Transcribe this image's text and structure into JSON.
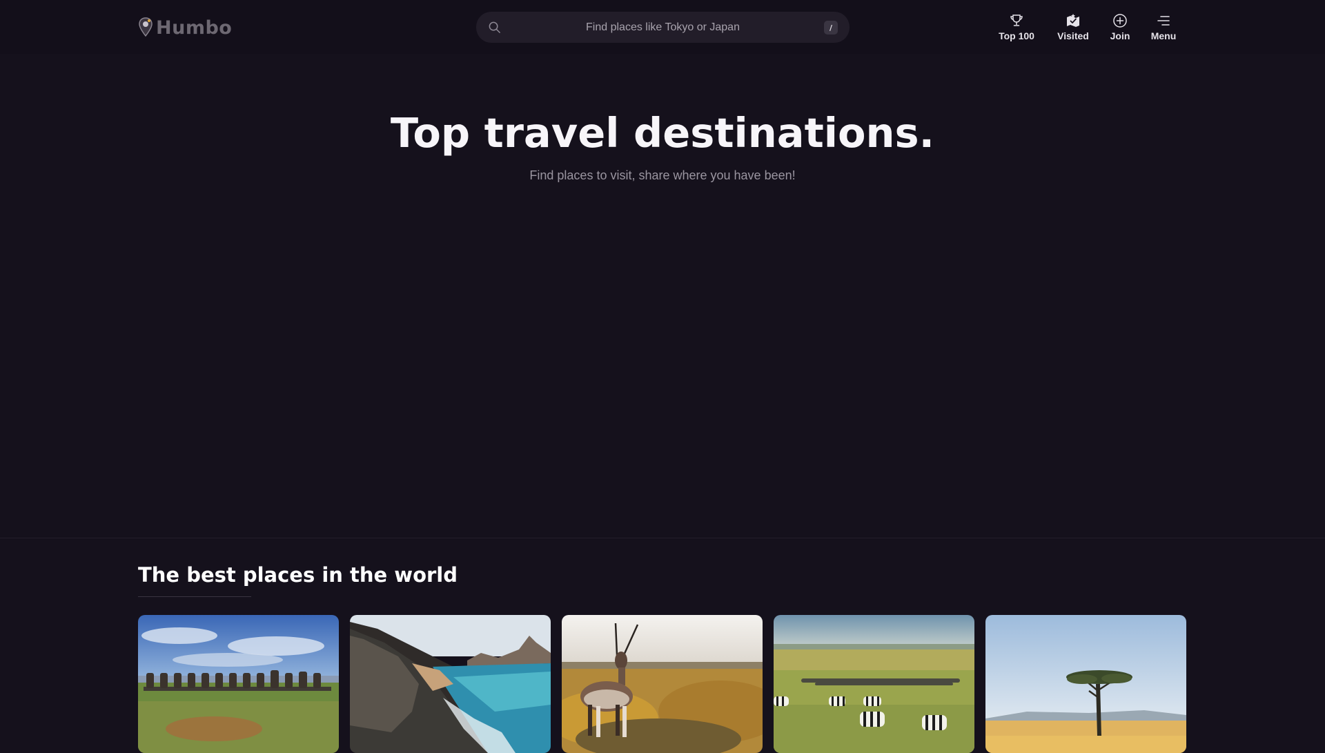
{
  "header": {
    "logo_text": "Humbo",
    "search": {
      "placeholder": "Find places like Tokyo or Japan",
      "shortcut": "/"
    },
    "nav": [
      {
        "label": "Top 100",
        "icon": "trophy-icon"
      },
      {
        "label": "Visited",
        "icon": "map-check-icon"
      },
      {
        "label": "Join",
        "icon": "plus-circle-icon"
      },
      {
        "label": "Menu",
        "icon": "menu-icon"
      }
    ]
  },
  "hero": {
    "title": "Top travel destinations.",
    "subtitle": "Find places to visit, share where you have been!"
  },
  "section": {
    "title": "The best places in the world",
    "cards": [
      {
        "image": "moai-statues-photo"
      },
      {
        "image": "rocky-coastline-photo"
      },
      {
        "image": "oryx-antelope-photo"
      },
      {
        "image": "zebra-herd-savanna-photo"
      },
      {
        "image": "acacia-tree-savanna-photo"
      }
    ]
  },
  "colors": {
    "background": "#15111c",
    "header_bg": "#130f1a",
    "search_bg": "#221d29",
    "text_primary": "#ffffff",
    "text_muted": "#9a95a0"
  }
}
